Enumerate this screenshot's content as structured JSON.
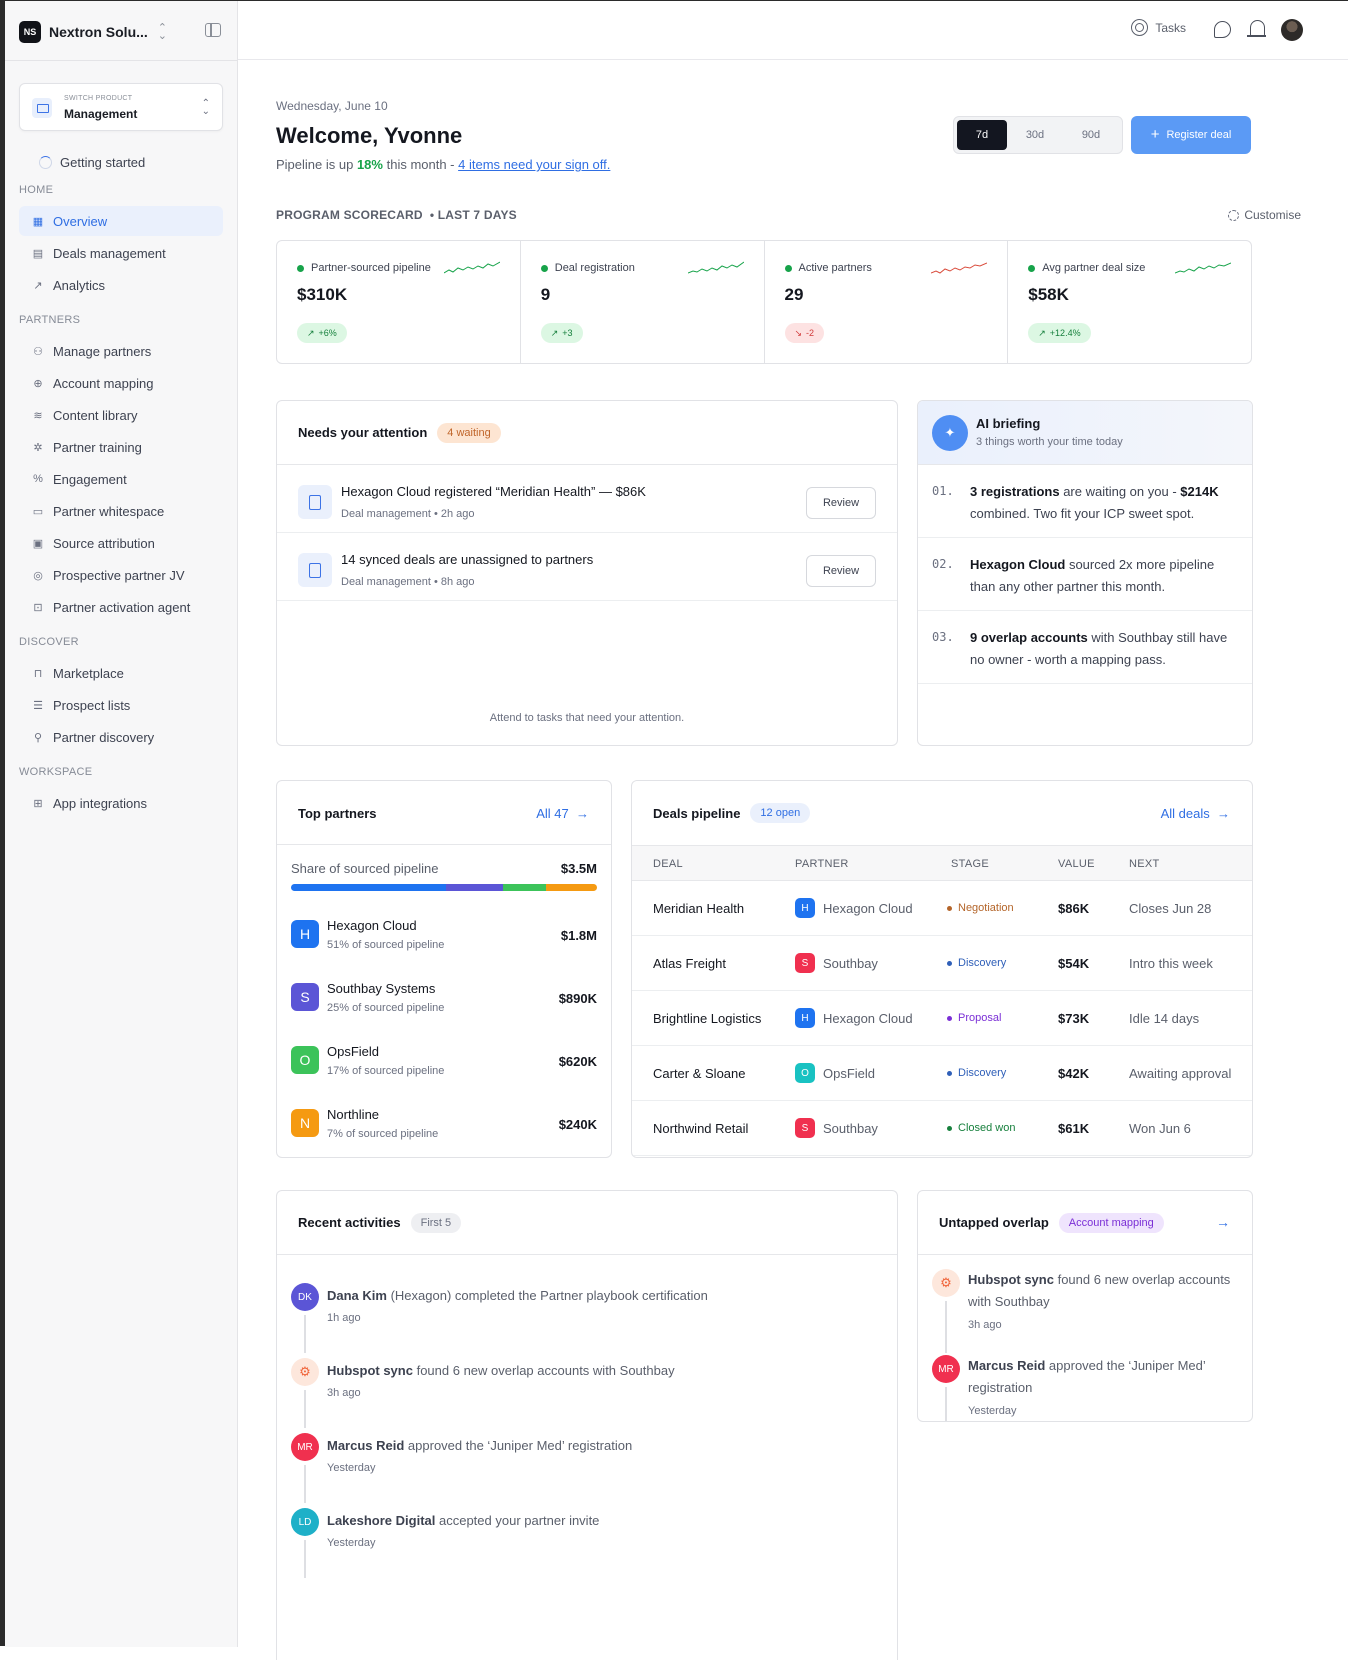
{
  "workspace": {
    "logo": "NS",
    "name": "Nextron Solu..."
  },
  "switch_product": {
    "caption": "SWITCH PRODUCT",
    "value": "Management"
  },
  "getting_started": "Getting started",
  "nav": {
    "home_label": "HOME",
    "home": [
      {
        "label": "Overview",
        "icon": "grid-icon"
      },
      {
        "label": "Deals management",
        "icon": "document-icon"
      },
      {
        "label": "Analytics",
        "icon": "trend-icon"
      }
    ],
    "partners_label": "PARTNERS",
    "partners": [
      {
        "label": "Manage partners",
        "icon": "users-icon"
      },
      {
        "label": "Account mapping",
        "icon": "globe-icon"
      },
      {
        "label": "Content library",
        "icon": "layers-icon"
      },
      {
        "label": "Partner training",
        "icon": "sparkle-icon"
      },
      {
        "label": "Engagement",
        "icon": "percent-icon"
      },
      {
        "label": "Partner whitespace",
        "icon": "board-icon"
      },
      {
        "label": "Source attribution",
        "icon": "table-icon"
      },
      {
        "label": "Prospective partner JV",
        "icon": "target-icon"
      },
      {
        "label": "Partner activation agent",
        "icon": "robot-icon"
      }
    ],
    "discover_label": "DISCOVER",
    "discover": [
      {
        "label": "Marketplace",
        "icon": "bag-icon"
      },
      {
        "label": "Prospect lists",
        "icon": "list-search-icon"
      },
      {
        "label": "Partner discovery",
        "icon": "compass-icon"
      }
    ],
    "workspace_label": "WORKSPACE",
    "workspace": [
      {
        "label": "App integrations",
        "icon": "apps-icon"
      }
    ]
  },
  "topbar": {
    "tasks": "Tasks"
  },
  "header": {
    "date": "Wednesday, June 10",
    "welcome": "Welcome, Yvonne",
    "sub_prefix": "Pipeline is up ",
    "sub_pct": "18%",
    "sub_mid": " this month - ",
    "sub_link": "4 items need your sign off.",
    "ranges": [
      "7d",
      "30d",
      "90d"
    ],
    "register": "Register deal"
  },
  "scorecard": {
    "title": "PROGRAM SCORECARD",
    "period": "• LAST 7 DAYS",
    "customise": "Customise",
    "kpis": [
      {
        "label": "Partner-sourced pipeline",
        "value": "$310K",
        "delta": "+6%",
        "trend": "up",
        "color": "#17a34a"
      },
      {
        "label": "Deal registration",
        "value": "9",
        "delta": "+3",
        "trend": "up",
        "color": "#17a34a"
      },
      {
        "label": "Active partners",
        "value": "29",
        "delta": "-2",
        "trend": "down",
        "color": "#d94a3a"
      },
      {
        "label": "Avg partner deal size",
        "value": "$58K",
        "delta": "+12.4%",
        "trend": "up",
        "color": "#17a34a"
      }
    ]
  },
  "attention": {
    "title": "Needs your attention",
    "badge": "4 waiting",
    "items": [
      {
        "title": "Hexagon Cloud registered “Meridian Health” — $86K",
        "sub": "Deal management • 2h ago",
        "action": "Review"
      },
      {
        "title": "14 synced deals are unassigned to partners",
        "sub": "Deal management • 8h ago",
        "action": "Review"
      }
    ],
    "footer": "Attend to tasks that need your attention."
  },
  "ai": {
    "title": "AI briefing",
    "sub": "3 things worth your time today",
    "items": [
      {
        "num": "01.",
        "bold": "3 registrations",
        "text": " are waiting on you - ",
        "bold2": "$214K",
        "text2": " combined. Two fit your ICP sweet spot."
      },
      {
        "num": "02.",
        "bold": "Hexagon Cloud",
        "text": " sourced 2x more pipeline than any other partner this month.",
        "bold2": "",
        "text2": ""
      },
      {
        "num": "03.",
        "bold": "9 overlap accounts",
        "text": " with Southbay still have no owner - worth a mapping pass.",
        "bold2": "",
        "text2": ""
      }
    ]
  },
  "top_partners": {
    "title": "Top partners",
    "all": "All 47",
    "share_label": "Share of sourced pipeline",
    "share_value": "$3.5M",
    "share_segments": [
      {
        "pct": 51,
        "color": "#1e73f0"
      },
      {
        "pct": 19,
        "color": "#5b55d6"
      },
      {
        "pct": 14,
        "color": "#3cc35a"
      },
      {
        "pct": 17,
        "color": "#f59a12"
      }
    ],
    "partners": [
      {
        "initial": "H",
        "name": "Hexagon Cloud",
        "sub": "51% of sourced pipeline",
        "value": "$1.8M",
        "color": "#1e73f0"
      },
      {
        "initial": "S",
        "name": "Southbay Systems",
        "sub": "25% of sourced pipeline",
        "value": "$890K",
        "color": "#5b55d6"
      },
      {
        "initial": "O",
        "name": "OpsField",
        "sub": "17% of sourced pipeline",
        "value": "$620K",
        "color": "#3cc35a"
      },
      {
        "initial": "N",
        "name": "Northline",
        "sub": "7% of sourced pipeline",
        "value": "$240K",
        "color": "#f59a12"
      }
    ]
  },
  "deals": {
    "title": "Deals pipeline",
    "badge": "12 open",
    "all": "All deals",
    "columns": [
      "DEAL",
      "PARTNER",
      "STAGE",
      "VALUE",
      "NEXT"
    ],
    "rows": [
      {
        "deal": "Meridian Health",
        "partner_initial": "H",
        "partner": "Hexagon Cloud",
        "partner_color": "#1e73f0",
        "stage": "Negotiation",
        "stage_color": "#b4652a",
        "value": "$86K",
        "next": "Closes Jun 28"
      },
      {
        "deal": "Atlas Freight",
        "partner_initial": "S",
        "partner": "Southbay",
        "partner_color": "#f0304f",
        "stage": "Discovery",
        "stage_color": "#2f5fb8",
        "value": "$54K",
        "next": "Intro this week"
      },
      {
        "deal": "Brightline Logistics",
        "partner_initial": "H",
        "partner": "Hexagon Cloud",
        "partner_color": "#1e73f0",
        "stage": "Proposal",
        "stage_color": "#7b2fd6",
        "value": "$73K",
        "next": "Idle 14 days"
      },
      {
        "deal": "Carter & Sloane",
        "partner_initial": "O",
        "partner": "OpsField",
        "partner_color": "#19c2c2",
        "stage": "Discovery",
        "stage_color": "#2f5fb8",
        "value": "$42K",
        "next": "Awaiting approval"
      },
      {
        "deal": "Northwind Retail",
        "partner_initial": "S",
        "partner": "Southbay",
        "partner_color": "#f0304f",
        "stage": "Closed won",
        "stage_color": "#17803d",
        "value": "$61K",
        "next": "Won Jun 6"
      }
    ]
  },
  "activities": {
    "title": "Recent activities",
    "badge": "First 5",
    "items": [
      {
        "initials": "DK",
        "color": "#5b55d6",
        "bold": "Dana Kim",
        "text": " (Hexagon) completed the Partner playbook certification",
        "time": "1h ago"
      },
      {
        "initials": "",
        "color": "hub",
        "bold": "Hubspot sync",
        "text": " found 6 new overlap accounts with Southbay",
        "time": "3h ago"
      },
      {
        "initials": "MR",
        "color": "#f0304f",
        "bold": "Marcus Reid",
        "text": " approved the ‘Juniper Med’ registration",
        "time": "Yesterday"
      },
      {
        "initials": "LD",
        "color": "#1eb0c8",
        "bold": "Lakeshore Digital",
        "text": " accepted your partner invite",
        "time": "Yesterday"
      }
    ]
  },
  "overlap": {
    "title": "Untapped overlap",
    "badge": "Account mapping",
    "items": [
      {
        "initials": "",
        "color": "hub",
        "bold": "Hubspot sync",
        "text": " found 6 new overlap accounts with Southbay",
        "time": "3h ago"
      },
      {
        "initials": "MR",
        "color": "#f0304f",
        "bold": "Marcus Reid",
        "text": " approved the ‘Juniper Med’ registration",
        "time": "Yesterday"
      }
    ]
  }
}
